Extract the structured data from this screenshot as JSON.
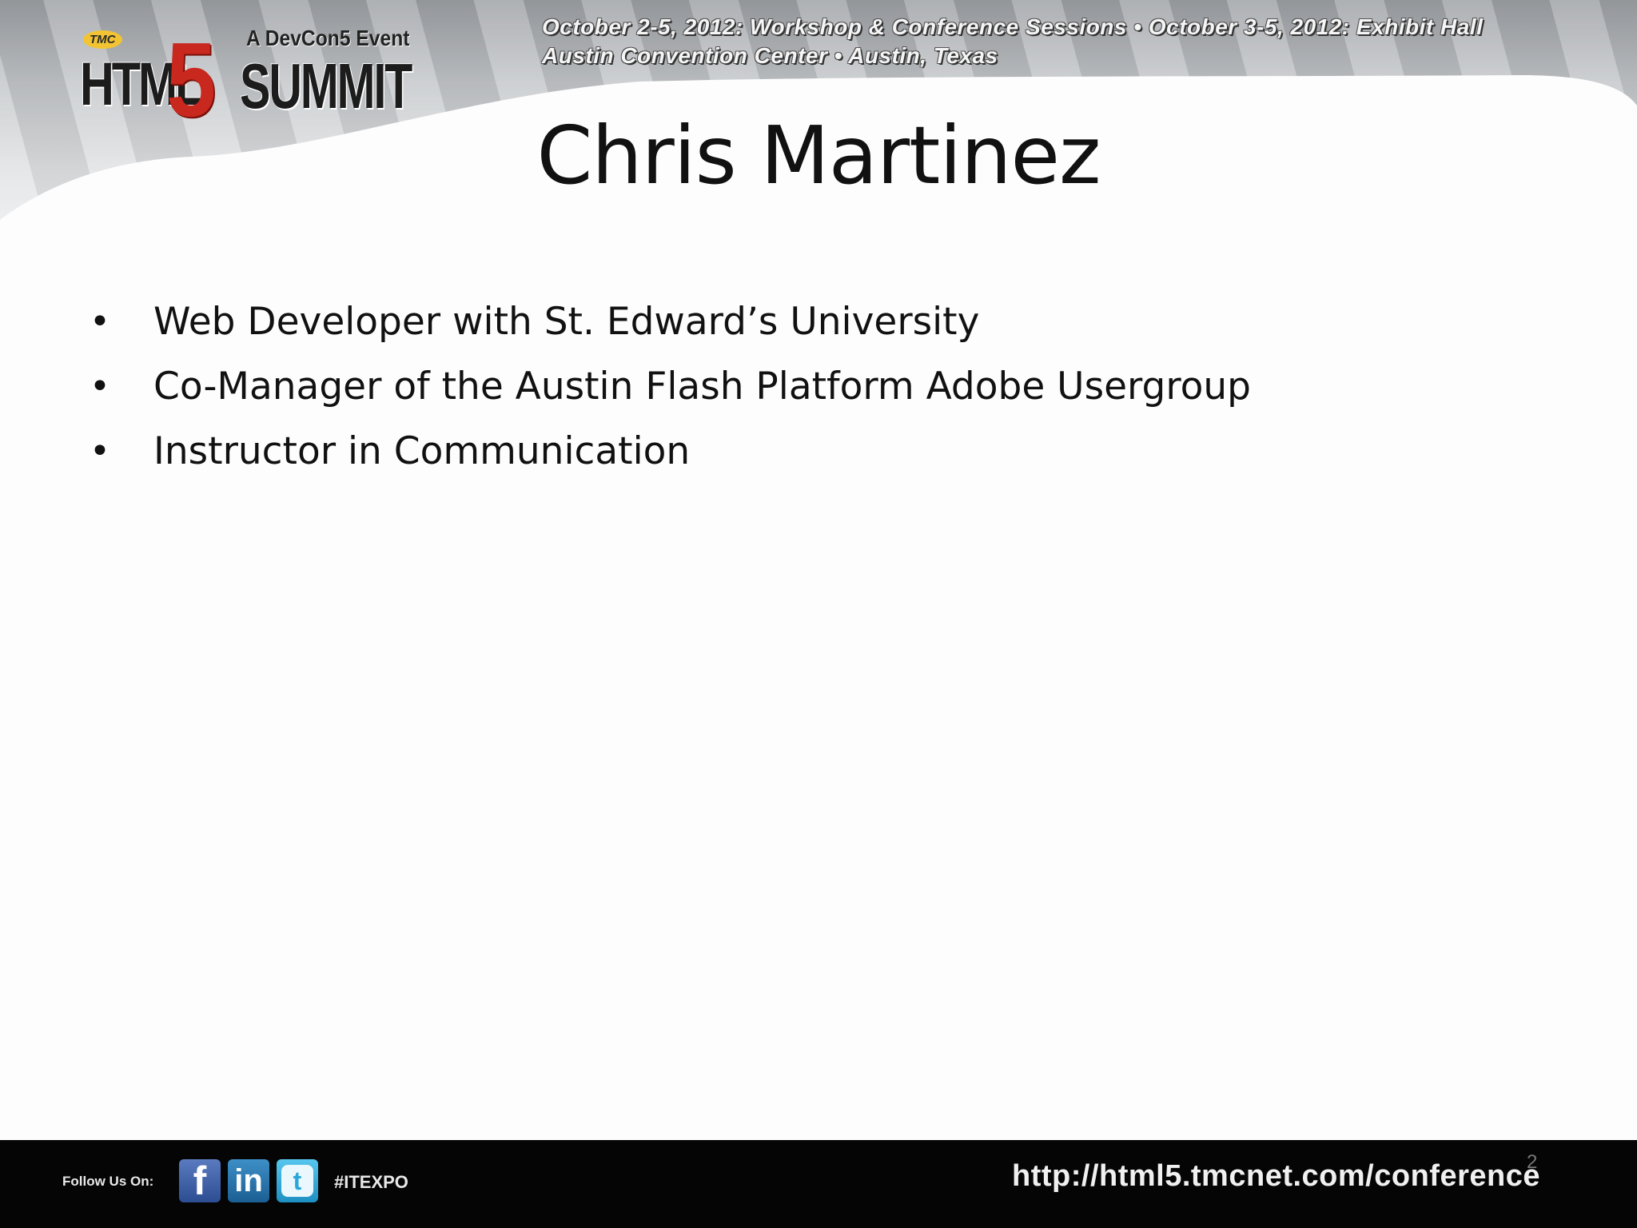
{
  "header": {
    "logo": {
      "tmc": "TMC",
      "html": "HTML",
      "five": "5",
      "event_tag": "A DevCon5 Event",
      "summit": "SUMMIT"
    },
    "event_line_1": "October 2-5, 2012: Workshop & Conference Sessions • October 3-5, 2012: Exhibit Hall",
    "event_line_2": "Austin Convention Center • Austin, Texas"
  },
  "slide": {
    "title": "Chris Martinez",
    "bullet_glyph": "•",
    "bullets": [
      "Web Developer with St. Edward’s University",
      "Co-Manager of the Austin Flash Platform Adobe Usergroup",
      "Instructor in Communication"
    ],
    "page_number": "2"
  },
  "footer": {
    "follow_label": "Follow Us On:",
    "facebook_glyph": "f",
    "linkedin_glyph": "in",
    "twitter_glyph": "t",
    "hashtag": "#ITEXPO",
    "url": "http://html5.tmcnet.com/conference"
  },
  "colors": {
    "logo_red": "#c8281e",
    "footer_bg": "#050505",
    "text": "#111111"
  }
}
